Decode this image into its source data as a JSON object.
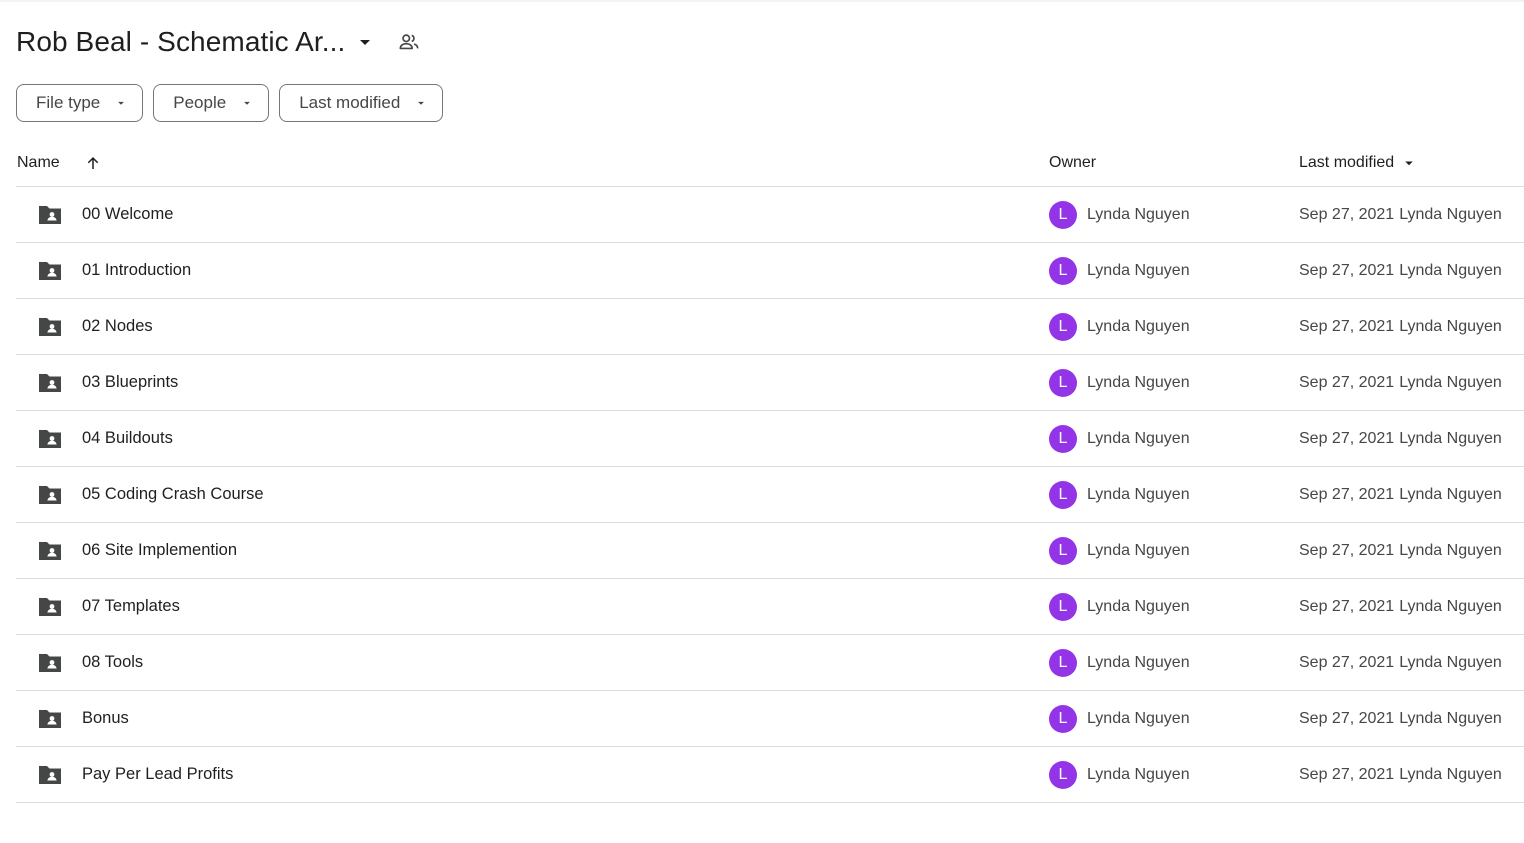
{
  "header": {
    "title": "Rob Beal - Schematic Ar...",
    "title_caret_icon": "arrow-drop-down-icon",
    "share_icon": "people-icon"
  },
  "filters": [
    {
      "label": "File type"
    },
    {
      "label": "People"
    },
    {
      "label": "Last modified"
    }
  ],
  "columns": {
    "name": "Name",
    "owner": "Owner",
    "last_modified": "Last modified"
  },
  "colors": {
    "avatar": "#9334e6",
    "folder_icon": "#444746"
  },
  "rows": [
    {
      "name": "00 Welcome",
      "owner_initial": "L",
      "owner": "Lynda Nguyen",
      "date": "Sep 27, 2021",
      "modified_by": "Lynda Nguyen"
    },
    {
      "name": "01 Introduction",
      "owner_initial": "L",
      "owner": "Lynda Nguyen",
      "date": "Sep 27, 2021",
      "modified_by": "Lynda Nguyen"
    },
    {
      "name": "02 Nodes",
      "owner_initial": "L",
      "owner": "Lynda Nguyen",
      "date": "Sep 27, 2021",
      "modified_by": "Lynda Nguyen"
    },
    {
      "name": "03 Blueprints",
      "owner_initial": "L",
      "owner": "Lynda Nguyen",
      "date": "Sep 27, 2021",
      "modified_by": "Lynda Nguyen"
    },
    {
      "name": "04 Buildouts",
      "owner_initial": "L",
      "owner": "Lynda Nguyen",
      "date": "Sep 27, 2021",
      "modified_by": "Lynda Nguyen"
    },
    {
      "name": "05 Coding Crash Course",
      "owner_initial": "L",
      "owner": "Lynda Nguyen",
      "date": "Sep 27, 2021",
      "modified_by": "Lynda Nguyen"
    },
    {
      "name": "06 Site Implemention",
      "owner_initial": "L",
      "owner": "Lynda Nguyen",
      "date": "Sep 27, 2021",
      "modified_by": "Lynda Nguyen"
    },
    {
      "name": "07 Templates",
      "owner_initial": "L",
      "owner": "Lynda Nguyen",
      "date": "Sep 27, 2021",
      "modified_by": "Lynda Nguyen"
    },
    {
      "name": "08 Tools",
      "owner_initial": "L",
      "owner": "Lynda Nguyen",
      "date": "Sep 27, 2021",
      "modified_by": "Lynda Nguyen"
    },
    {
      "name": "Bonus",
      "owner_initial": "L",
      "owner": "Lynda Nguyen",
      "date": "Sep 27, 2021",
      "modified_by": "Lynda Nguyen"
    },
    {
      "name": "Pay Per Lead Profits",
      "owner_initial": "L",
      "owner": "Lynda Nguyen",
      "date": "Sep 27, 2021",
      "modified_by": "Lynda Nguyen"
    }
  ]
}
